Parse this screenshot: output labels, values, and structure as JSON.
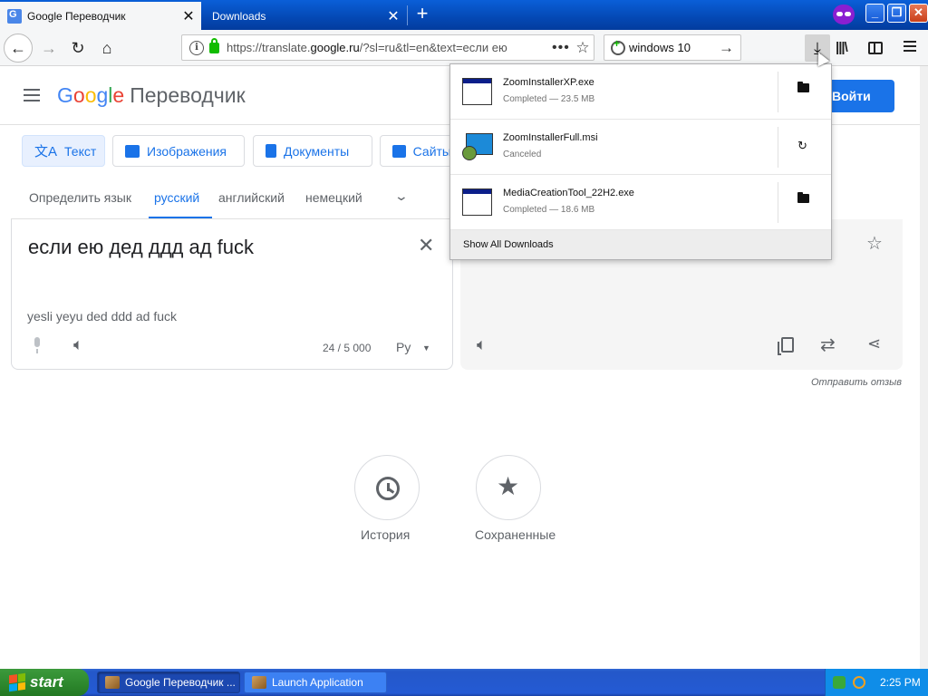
{
  "browser": {
    "tabs": [
      {
        "title": "Google Переводчик",
        "active": true
      },
      {
        "title": "Downloads",
        "active": false
      }
    ],
    "url_prefix": "https://translate.",
    "url_domain": "google.ru",
    "url_rest": "/?sl=ru&tl=en&text=если ею",
    "search_value": "windows  10"
  },
  "translate": {
    "logo": {
      "g": "G",
      "o1": "o",
      "o2": "o",
      "g2": "g",
      "l": "l",
      "e": "e",
      "product": "Переводчик"
    },
    "signin_label": "Войти",
    "modes": {
      "text": "Текст",
      "images": "Изображения",
      "documents": "Документы",
      "sites": "Сайты"
    },
    "langs": {
      "detect": "Определить язык",
      "ru": "русский",
      "en": "английский",
      "de": "немецкий"
    },
    "source_text": "если ею дед ддд ад fuck",
    "transliteration": "yesli yeyu ded ddd ad fuck",
    "counter": "24 / 5 000",
    "ime": "Ру",
    "feedback": "Отправить отзыв",
    "history_label": "История",
    "saved_label": "Сохраненные"
  },
  "downloads": {
    "items": [
      {
        "name": "ZoomInstallerXP.exe",
        "status": "Completed — 23.5 MB",
        "action": "open-folder"
      },
      {
        "name": "ZoomInstallerFull.msi",
        "status": "Canceled",
        "action": "retry"
      },
      {
        "name": "MediaCreationTool_22H2.exe",
        "status": "Completed — 18.6 MB",
        "action": "open-folder"
      }
    ],
    "show_all": "Show All Downloads"
  },
  "taskbar": {
    "start_label": "start",
    "tasks": [
      "Google Переводчик ...",
      "Launch Application"
    ],
    "clock": "2:25 PM"
  },
  "colors": {
    "accent": "#1a73e8",
    "xp_blue": "#245ad4",
    "start_green": "#2f8a2f"
  }
}
